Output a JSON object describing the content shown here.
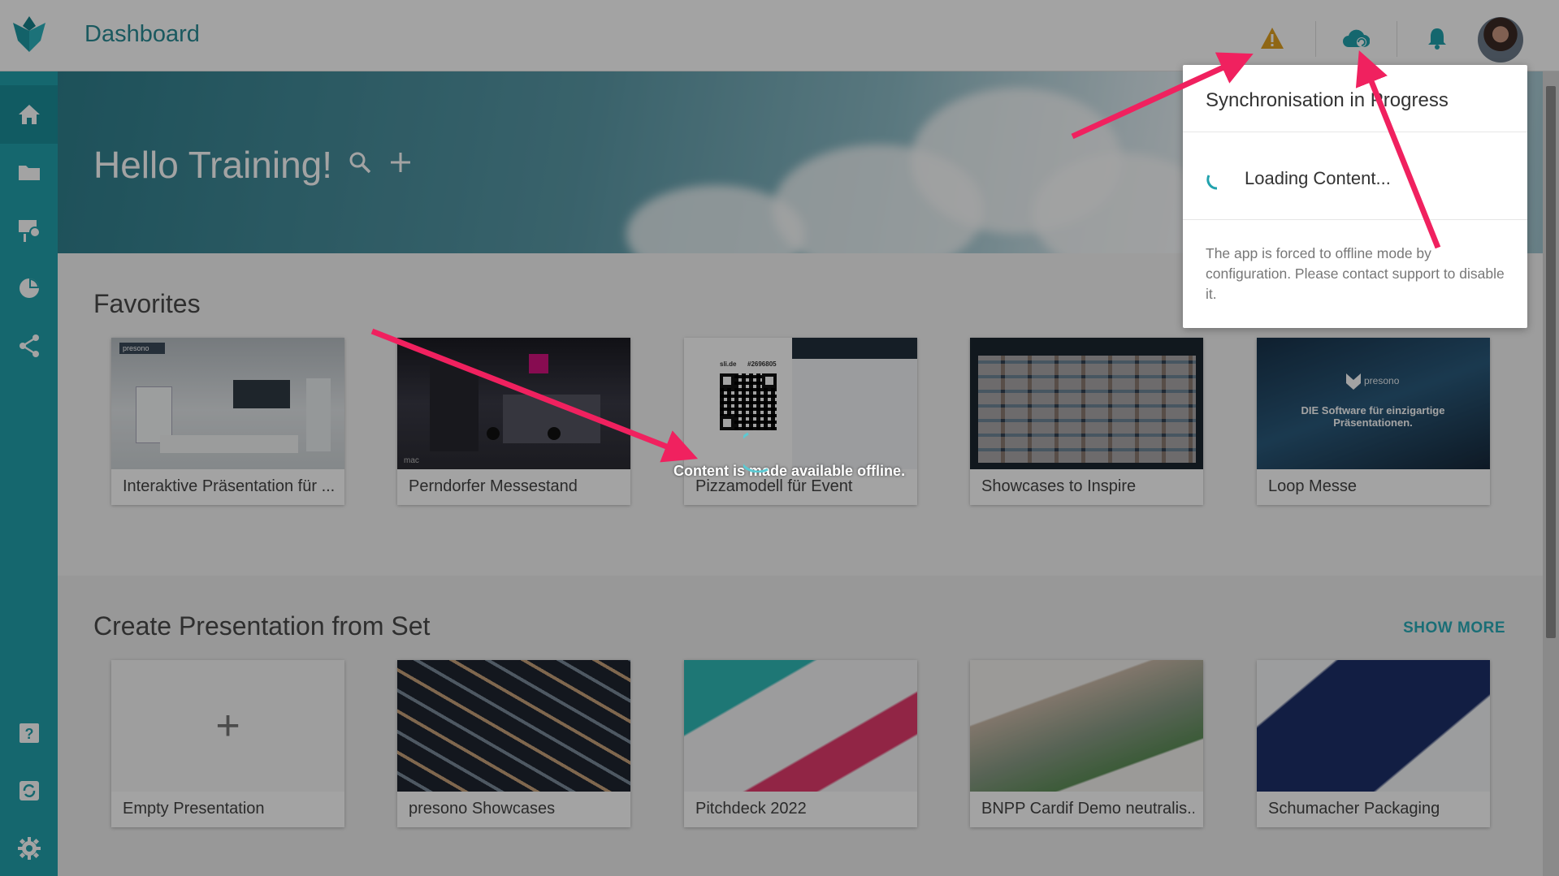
{
  "header": {
    "title": "Dashboard",
    "icons": [
      "warning-icon",
      "cloud-sync-icon",
      "bell-icon"
    ]
  },
  "sidebar": {
    "items": [
      {
        "name": "home",
        "icon": "home-icon"
      },
      {
        "name": "folder",
        "icon": "folder-icon"
      },
      {
        "name": "presentation",
        "icon": "presentation-icon"
      },
      {
        "name": "analytics",
        "icon": "pie-chart-icon"
      },
      {
        "name": "share",
        "icon": "share-icon"
      }
    ],
    "bottom_items": [
      {
        "name": "help",
        "icon": "help-icon"
      },
      {
        "name": "sync",
        "icon": "sync-icon"
      },
      {
        "name": "settings",
        "icon": "gear-icon"
      }
    ]
  },
  "hero": {
    "greeting": "Hello Training!"
  },
  "favorites": {
    "title": "Favorites",
    "cards": [
      {
        "label": "Interaktive Präsentation für ..."
      },
      {
        "label": "Perndorfer Messestand"
      },
      {
        "label": "Pizzamodell für Event"
      },
      {
        "label": "Showcases to Inspire"
      },
      {
        "label": "Loop Messe"
      }
    ]
  },
  "thumb_text": {
    "presono_badge": "presono",
    "mac": "mac",
    "qr_left": "sli.de",
    "qr_right": "#2696805",
    "loop_brand": "presono",
    "loop_tagline": "DIE Software für einzigartige Präsentationen."
  },
  "sets": {
    "title": "Create Presentation from Set",
    "show_more": "SHOW MORE",
    "cards": [
      {
        "label": "Empty Presentation"
      },
      {
        "label": "presono Showcases"
      },
      {
        "label": "Pitchdeck 2022"
      },
      {
        "label": "BNPP Cardif Demo neutralis..."
      },
      {
        "label": "Schumacher Packaging"
      }
    ],
    "empty_symbol": "+"
  },
  "sync_popup": {
    "title": "Synchronisation in Progress",
    "loading": "Loading Content...",
    "note": "The app is forced to offline mode by configuration. Please contact support to disable it."
  },
  "toast": "Content is made available offline.",
  "colors": {
    "accent": "#21a2ad",
    "arrow": "#f0215f",
    "warning": "#e0a020"
  }
}
